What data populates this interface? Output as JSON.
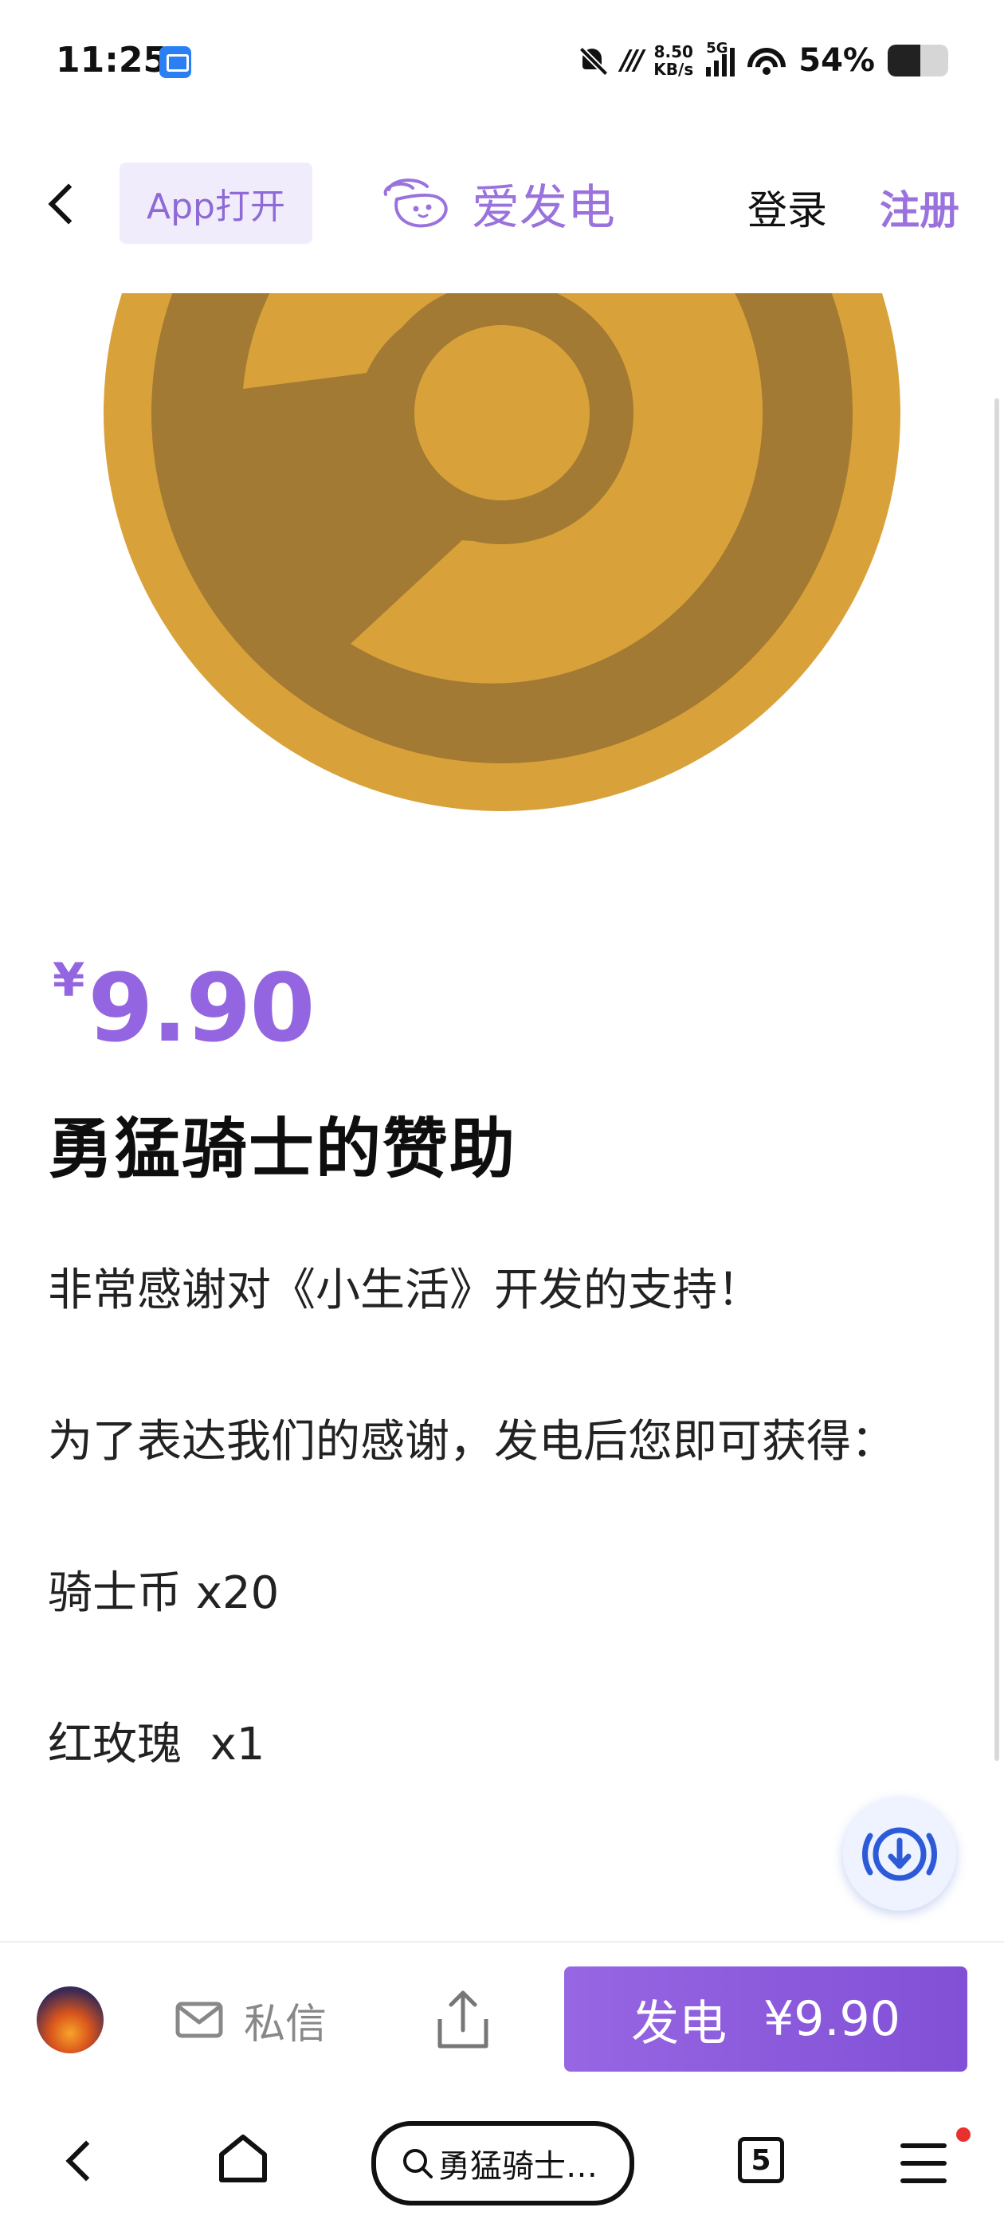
{
  "status_bar": {
    "time": "11:25",
    "net_speed_value": "8.50",
    "net_speed_unit": "KB/s",
    "network": "5G",
    "battery_percent": "54%",
    "battery_level": 0.54
  },
  "header": {
    "app_open_label": "App打开",
    "brand_name": "爱发电",
    "login_label": "登录",
    "register_label": "注册"
  },
  "product": {
    "currency_symbol": "¥",
    "price": "9.90",
    "title": "勇猛骑士的赞助",
    "description": [
      "非常感谢对《小生活》开发的支持！",
      "为了表达我们的感谢，发电后您即可获得：",
      "骑士币 x20",
      "红玫瑰  x1"
    ]
  },
  "action_bar": {
    "message_label": "私信",
    "power_label": "发电",
    "power_price": "¥9.90"
  },
  "browser_nav": {
    "url_text": "勇猛骑士…",
    "tab_count": "5"
  },
  "colors": {
    "accent": "#9465e0",
    "accent_light_bg": "#f1ecfb",
    "coin_outer": "#d9a13a",
    "coin_inner": "#a27a33"
  }
}
